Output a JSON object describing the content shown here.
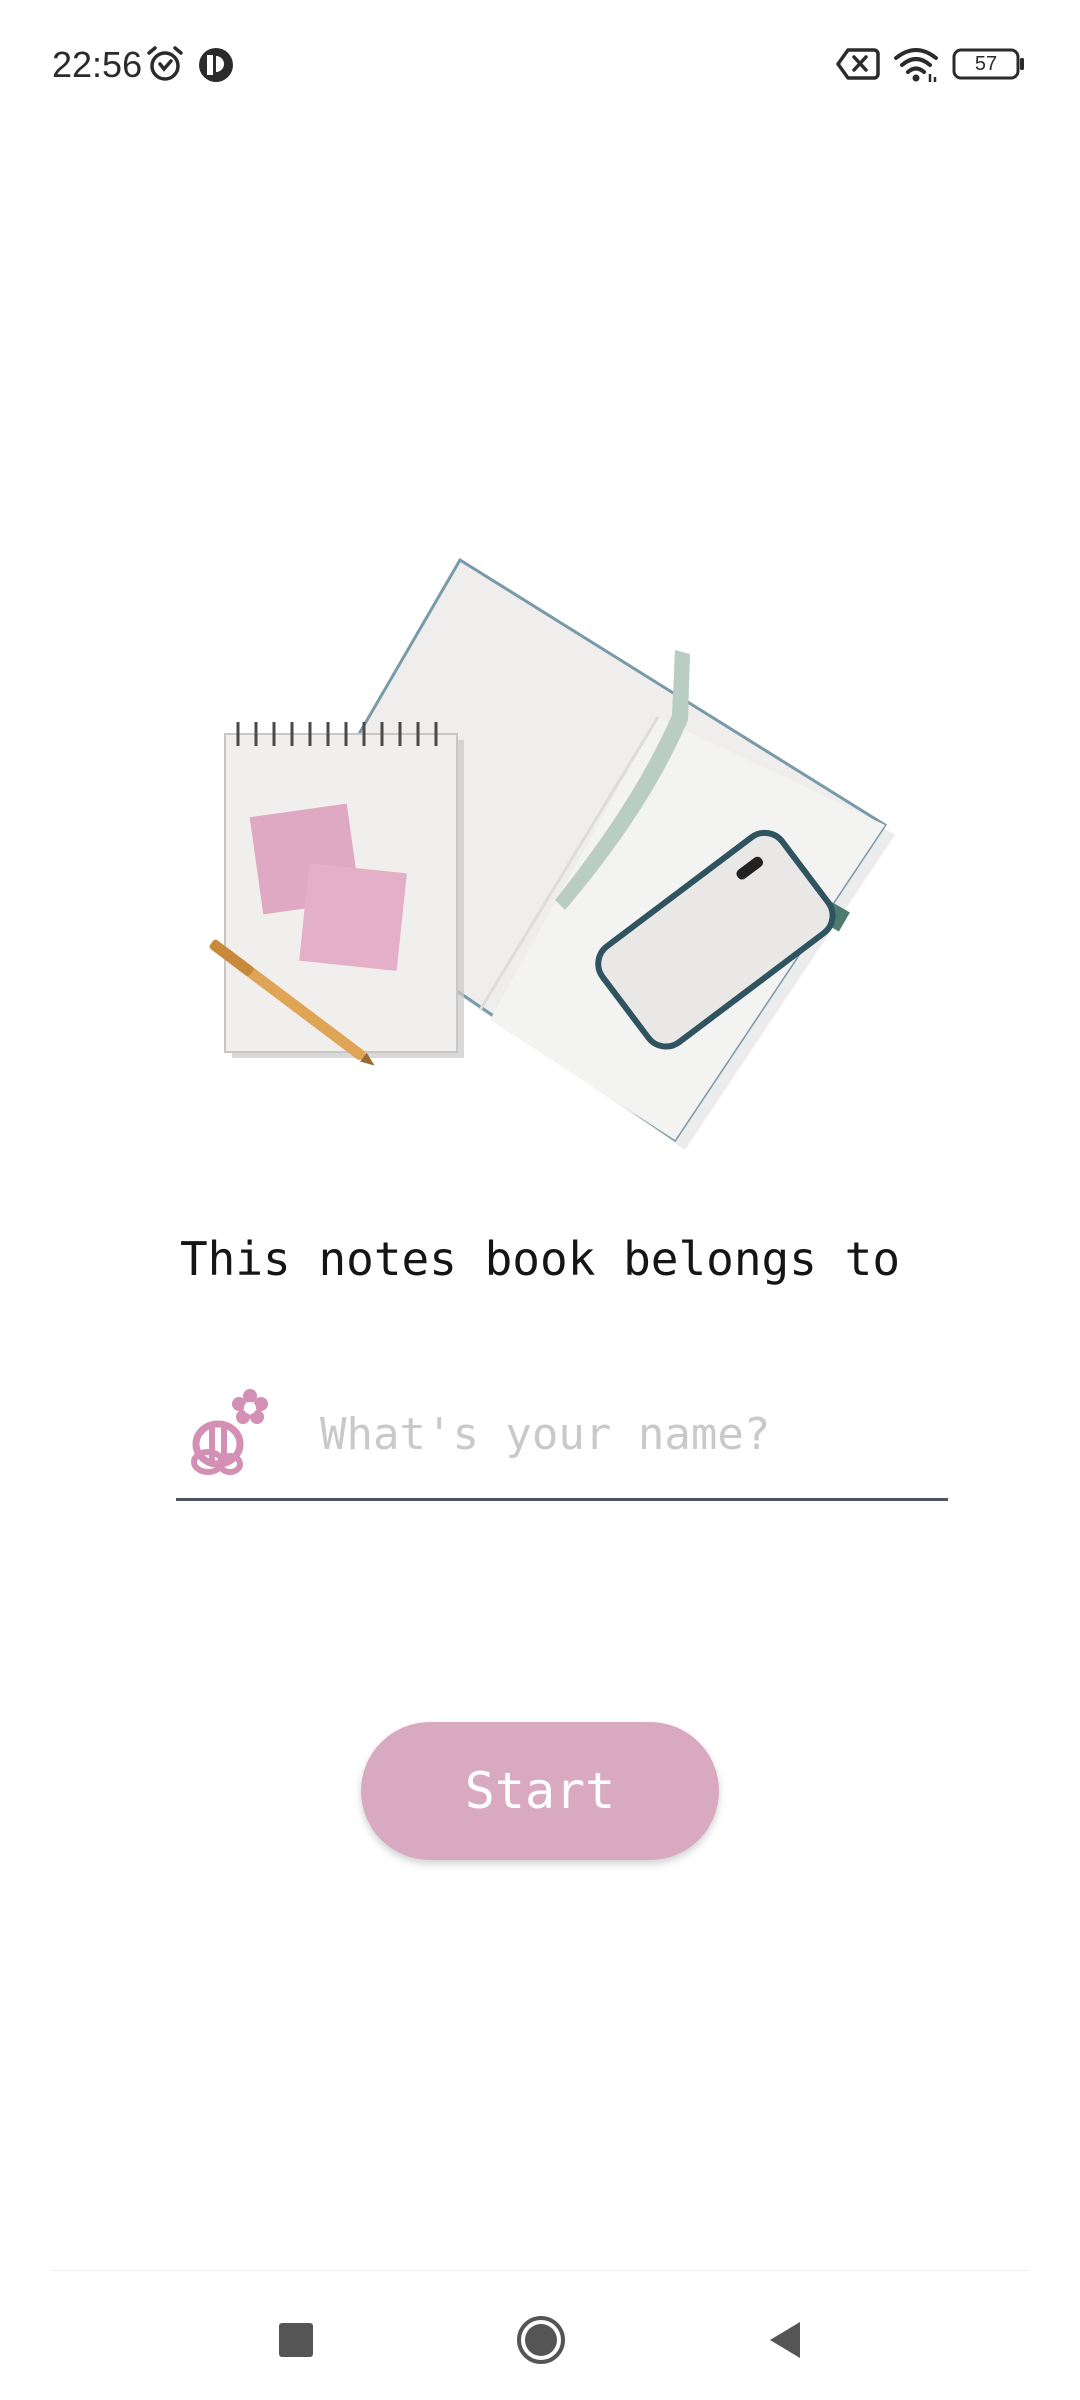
{
  "status_bar": {
    "time": "22:56",
    "icons_left": [
      "alarm-icon",
      "app-notification-icon"
    ],
    "icons_right": [
      "sim-error-icon",
      "wifi-icon",
      "battery-icon"
    ],
    "battery_level": "57"
  },
  "illustration": {
    "icon": "notebook-phone-illustration"
  },
  "prompt": {
    "text": "This notes book belongs to"
  },
  "name_field": {
    "icon": "bee-flower-icon",
    "placeholder": "What's your name?",
    "value": ""
  },
  "start_button": {
    "label": "Start"
  },
  "colors": {
    "accent": "#d8a9bf",
    "underline": "#4c5560",
    "icon_pink": "#d38fb4"
  },
  "nav_bar": {
    "buttons": [
      "recents-icon",
      "home-icon",
      "back-icon"
    ]
  }
}
